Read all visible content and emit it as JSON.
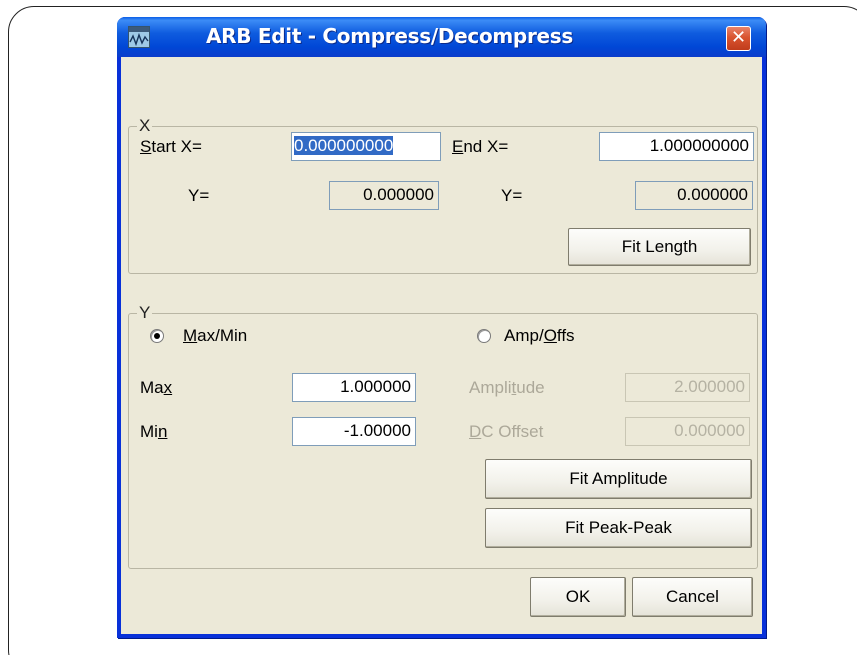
{
  "window": {
    "title": "ARB Edit - Compress/Decompress",
    "close_glyph": "✕",
    "icon": "waveform-icon"
  },
  "x_group": {
    "title": "X",
    "start_label": {
      "mnemonic": "S",
      "rest": "tart X="
    },
    "start_value": "0.000000000",
    "start_y_label": "Y=",
    "start_y_value": "0.000000",
    "end_label": {
      "mnemonic": "E",
      "rest": "nd  X="
    },
    "end_value": "1.000000000",
    "end_y_label": "Y=",
    "end_y_value": "0.000000",
    "fit_length_label": "Fit Length"
  },
  "y_group": {
    "title": "Y",
    "maxmin_radio": {
      "mnemonic": "M",
      "rest": "ax/Min",
      "checked": true
    },
    "ampoffs_radio": {
      "prefix": "Amp/",
      "mnemonic": "O",
      "rest": "ffs",
      "checked": false
    },
    "max_label": {
      "prefix": "Ma",
      "mnemonic": "x",
      "rest": ""
    },
    "max_value": "1.000000",
    "min_label": {
      "prefix": "Mi",
      "mnemonic": "n",
      "rest": ""
    },
    "min_value": "-1.00000",
    "amplitude_label": {
      "prefix": "Ampli",
      "mnemonic": "t",
      "rest": "ude"
    },
    "amplitude_value": "2.000000",
    "dc_offset_label": {
      "prefix": "",
      "mnemonic": "D",
      "rest": "C Offset"
    },
    "dc_offset_value": "0.000000",
    "fit_amplitude_label": "Fit Amplitude",
    "fit_peak_label": "Fit Peak-Peak"
  },
  "buttons": {
    "ok_label": "OK",
    "cancel_label": "Cancel"
  }
}
